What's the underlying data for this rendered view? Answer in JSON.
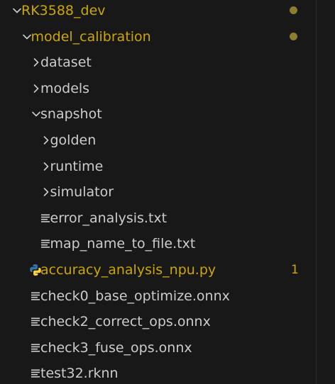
{
  "tree": [
    {
      "label": "RK3588_dev",
      "kind": "folder-open",
      "depth": 0,
      "modified": true,
      "badge": "dot"
    },
    {
      "label": "model_calibration",
      "kind": "folder-open",
      "depth": 1,
      "modified": true,
      "badge": "dot"
    },
    {
      "label": "dataset",
      "kind": "folder-closed",
      "depth": 2,
      "modified": false
    },
    {
      "label": "models",
      "kind": "folder-closed",
      "depth": 2,
      "modified": false
    },
    {
      "label": "snapshot",
      "kind": "folder-open",
      "depth": 2,
      "modified": false
    },
    {
      "label": "golden",
      "kind": "folder-closed",
      "depth": 3,
      "modified": false
    },
    {
      "label": "runtime",
      "kind": "folder-closed",
      "depth": 3,
      "modified": false
    },
    {
      "label": "simulator",
      "kind": "folder-closed",
      "depth": 3,
      "modified": false
    },
    {
      "label": "error_analysis.txt",
      "kind": "file-text",
      "depth": 3,
      "modified": false
    },
    {
      "label": "map_name_to_file.txt",
      "kind": "file-text",
      "depth": 3,
      "modified": false
    },
    {
      "label": "accuracy_analysis_npu.py",
      "kind": "file-python",
      "depth": 2,
      "modified": true,
      "badge": "1"
    },
    {
      "label": "check0_base_optimize.onnx",
      "kind": "file-text",
      "depth": 2,
      "modified": false
    },
    {
      "label": "check2_correct_ops.onnx",
      "kind": "file-text",
      "depth": 2,
      "modified": false
    },
    {
      "label": "check3_fuse_ops.onnx",
      "kind": "file-text",
      "depth": 2,
      "modified": false
    },
    {
      "label": "test32.rknn",
      "kind": "file-text",
      "depth": 2,
      "modified": false
    }
  ],
  "colors": {
    "background": "#181818",
    "text": "#cccccc",
    "modified": "#cca700",
    "dot": "#8c7d2e",
    "python_blue": "#3572a5",
    "python_yellow": "#ffd43b"
  }
}
